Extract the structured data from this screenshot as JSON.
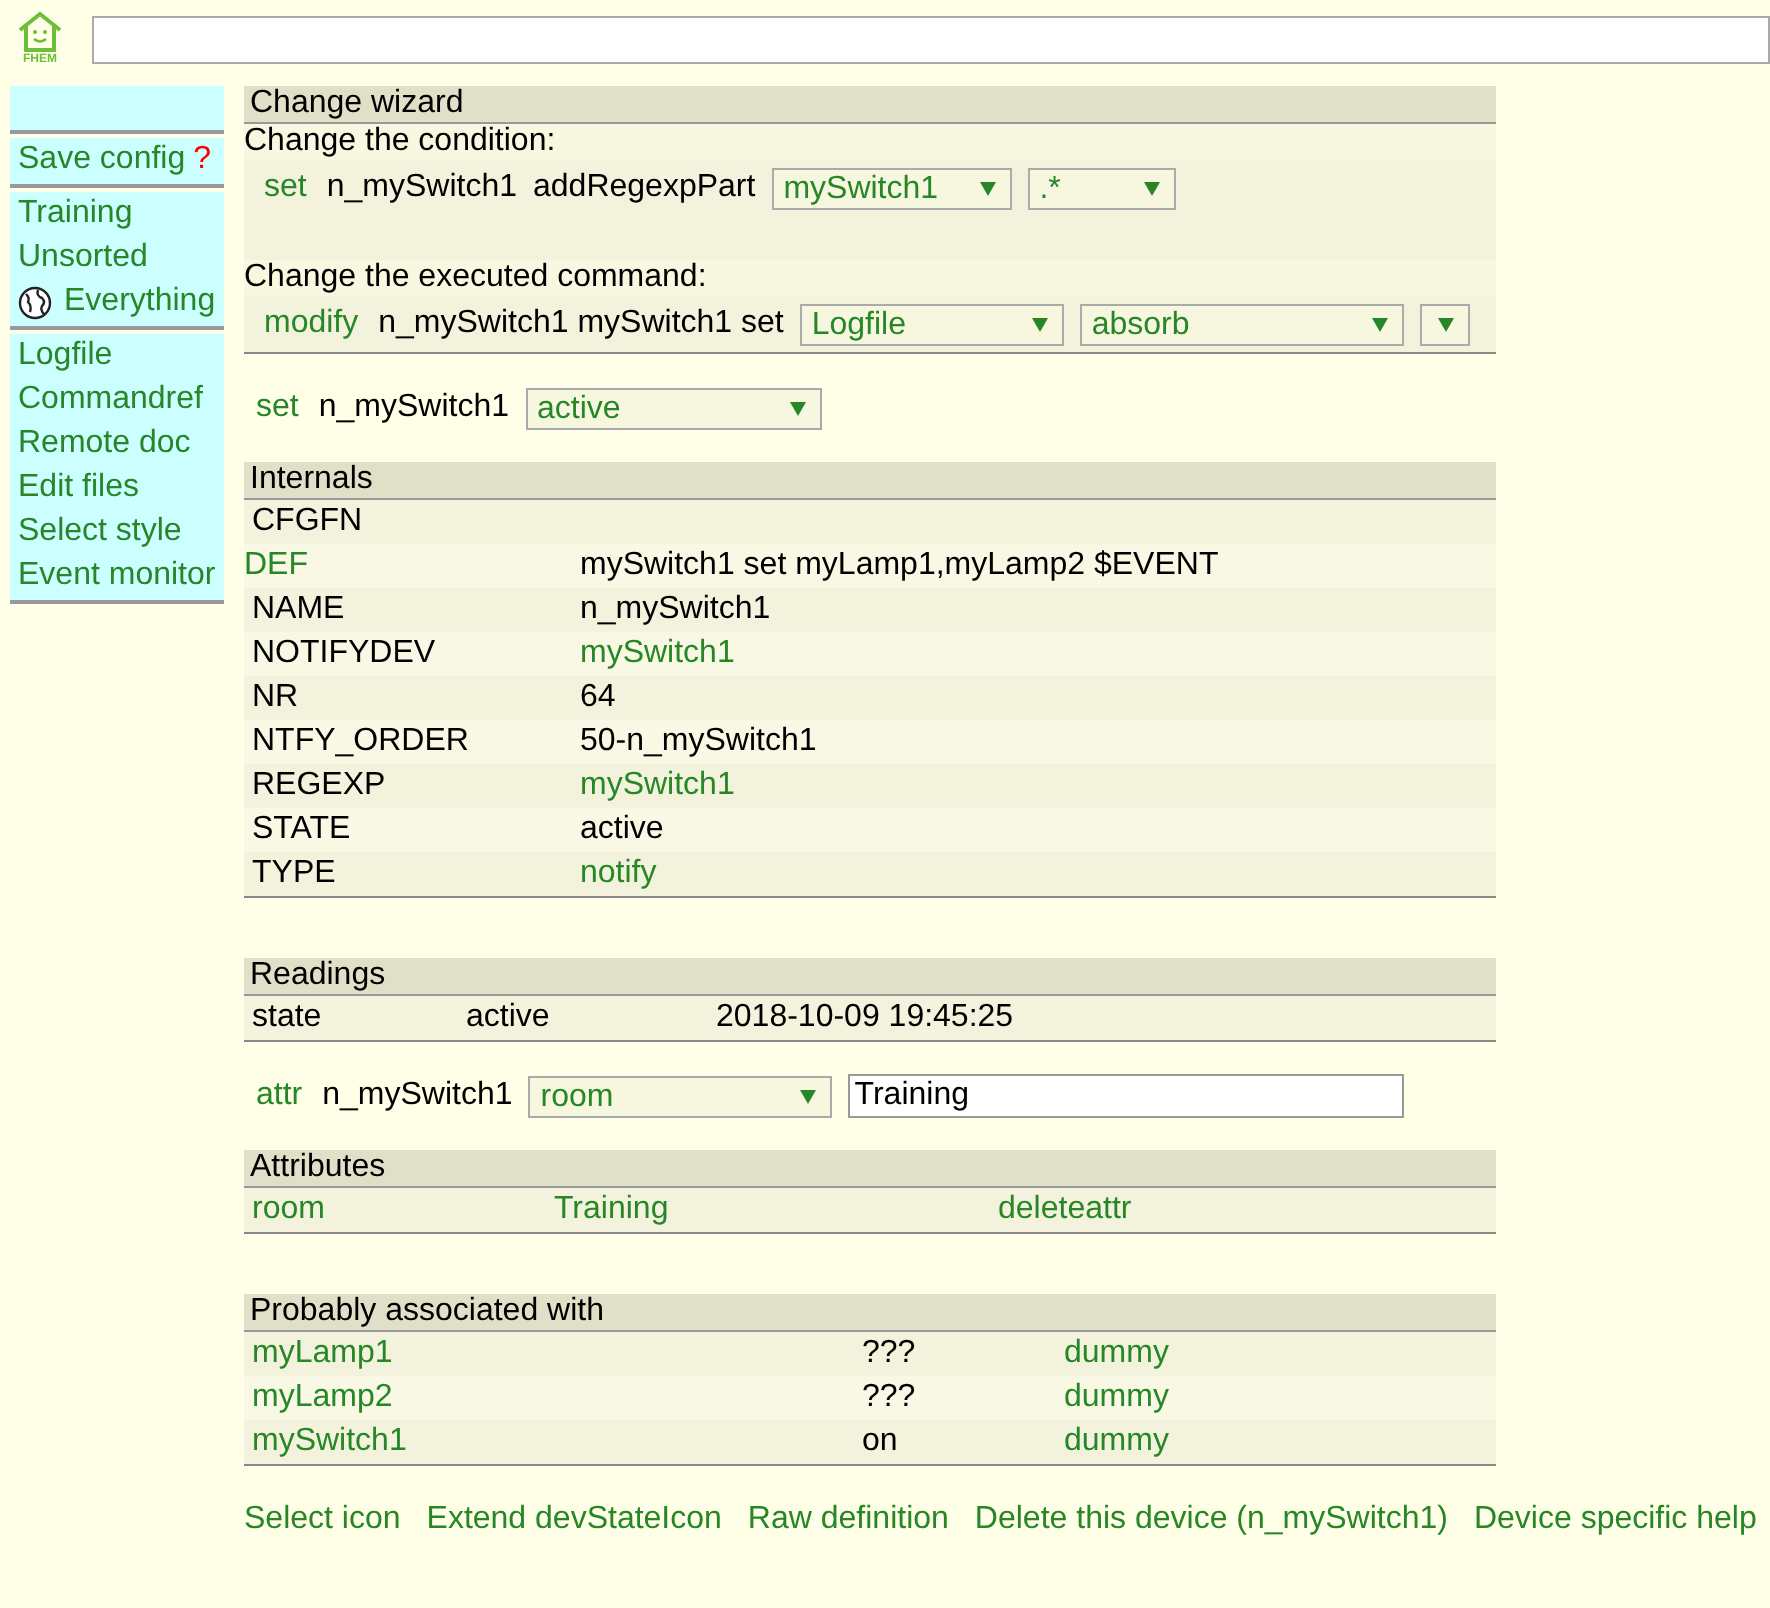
{
  "header": {
    "logo_text": "FHEM"
  },
  "sidebar": {
    "groups": [
      {
        "items": [
          {
            "label": "Save config",
            "icon": false,
            "badge": "?"
          }
        ]
      },
      {
        "items": [
          {
            "label": "Training",
            "icon": false
          },
          {
            "label": "Unsorted",
            "icon": false
          },
          {
            "label": "Everything",
            "icon": true
          }
        ]
      },
      {
        "items": [
          {
            "label": "Logfile",
            "icon": false
          },
          {
            "label": "Commandref",
            "icon": false
          },
          {
            "label": "Remote doc",
            "icon": false
          },
          {
            "label": "Edit files",
            "icon": false
          },
          {
            "label": "Select style",
            "icon": false
          },
          {
            "label": "Event monitor",
            "icon": false
          }
        ]
      }
    ]
  },
  "wizard": {
    "title": "Change wizard",
    "condition_label": "Change the condition:",
    "condition": {
      "command": "set",
      "device": "n_mySwitch1",
      "action": "addRegexpPart",
      "selects": [
        {
          "value": "mySwitch1"
        },
        {
          "value": ".*"
        }
      ]
    },
    "command_label": "Change the executed command:",
    "command": {
      "command": "modify",
      "text": "n_mySwitch1 mySwitch1 set",
      "selects": [
        {
          "kind": "text",
          "value": "Logfile"
        },
        {
          "kind": "text",
          "value": "absorb"
        },
        {
          "kind": "empty"
        }
      ]
    }
  },
  "set_line": {
    "command": "set",
    "device": "n_mySwitch1",
    "select": "active"
  },
  "internals": {
    "title": "Internals",
    "rows": [
      {
        "name": "CFGFN",
        "name_link": false
      },
      {
        "name": "DEF",
        "value": "mySwitch1 set myLamp1,myLamp2 $EVENT",
        "name_link": true,
        "value_link": false
      },
      {
        "name": "NAME",
        "value": "n_mySwitch1",
        "name_link": false,
        "value_link": false
      },
      {
        "name": "NOTIFYDEV",
        "value": "mySwitch1",
        "name_link": false,
        "value_link": true
      },
      {
        "name": "NR",
        "value": "64",
        "name_link": false,
        "value_link": false
      },
      {
        "name": "NTFY_ORDER",
        "value": "50-n_mySwitch1",
        "name_link": false,
        "value_link": false
      },
      {
        "name": "REGEXP",
        "value": "mySwitch1",
        "name_link": false,
        "value_link": true
      },
      {
        "name": "STATE",
        "value": "active",
        "name_link": false,
        "value_link": false
      },
      {
        "name": "TYPE",
        "value": "notify",
        "name_link": false,
        "value_link": true
      }
    ]
  },
  "readings": {
    "title": "Readings",
    "rows": [
      {
        "name": "state",
        "value": "active",
        "time": "2018-10-09 19:45:25"
      }
    ]
  },
  "attr_line": {
    "command": "attr",
    "device": "n_mySwitch1",
    "select": "room",
    "value": "Training"
  },
  "attributes": {
    "title": "Attributes",
    "rows": [
      {
        "name": "room",
        "value": "Training",
        "action": "deleteattr"
      }
    ]
  },
  "associated": {
    "title": "Probably associated with",
    "rows": [
      {
        "name": "myLamp1",
        "state": "???",
        "type": "dummy"
      },
      {
        "name": "myLamp2",
        "state": "???",
        "type": "dummy"
      },
      {
        "name": "mySwitch1",
        "state": "on",
        "type": "dummy"
      }
    ]
  },
  "footer_links": [
    "Select icon",
    "Extend devStateIcon",
    "Raw definition",
    "Delete this device (n_mySwitch1)",
    "Device specific help"
  ]
}
